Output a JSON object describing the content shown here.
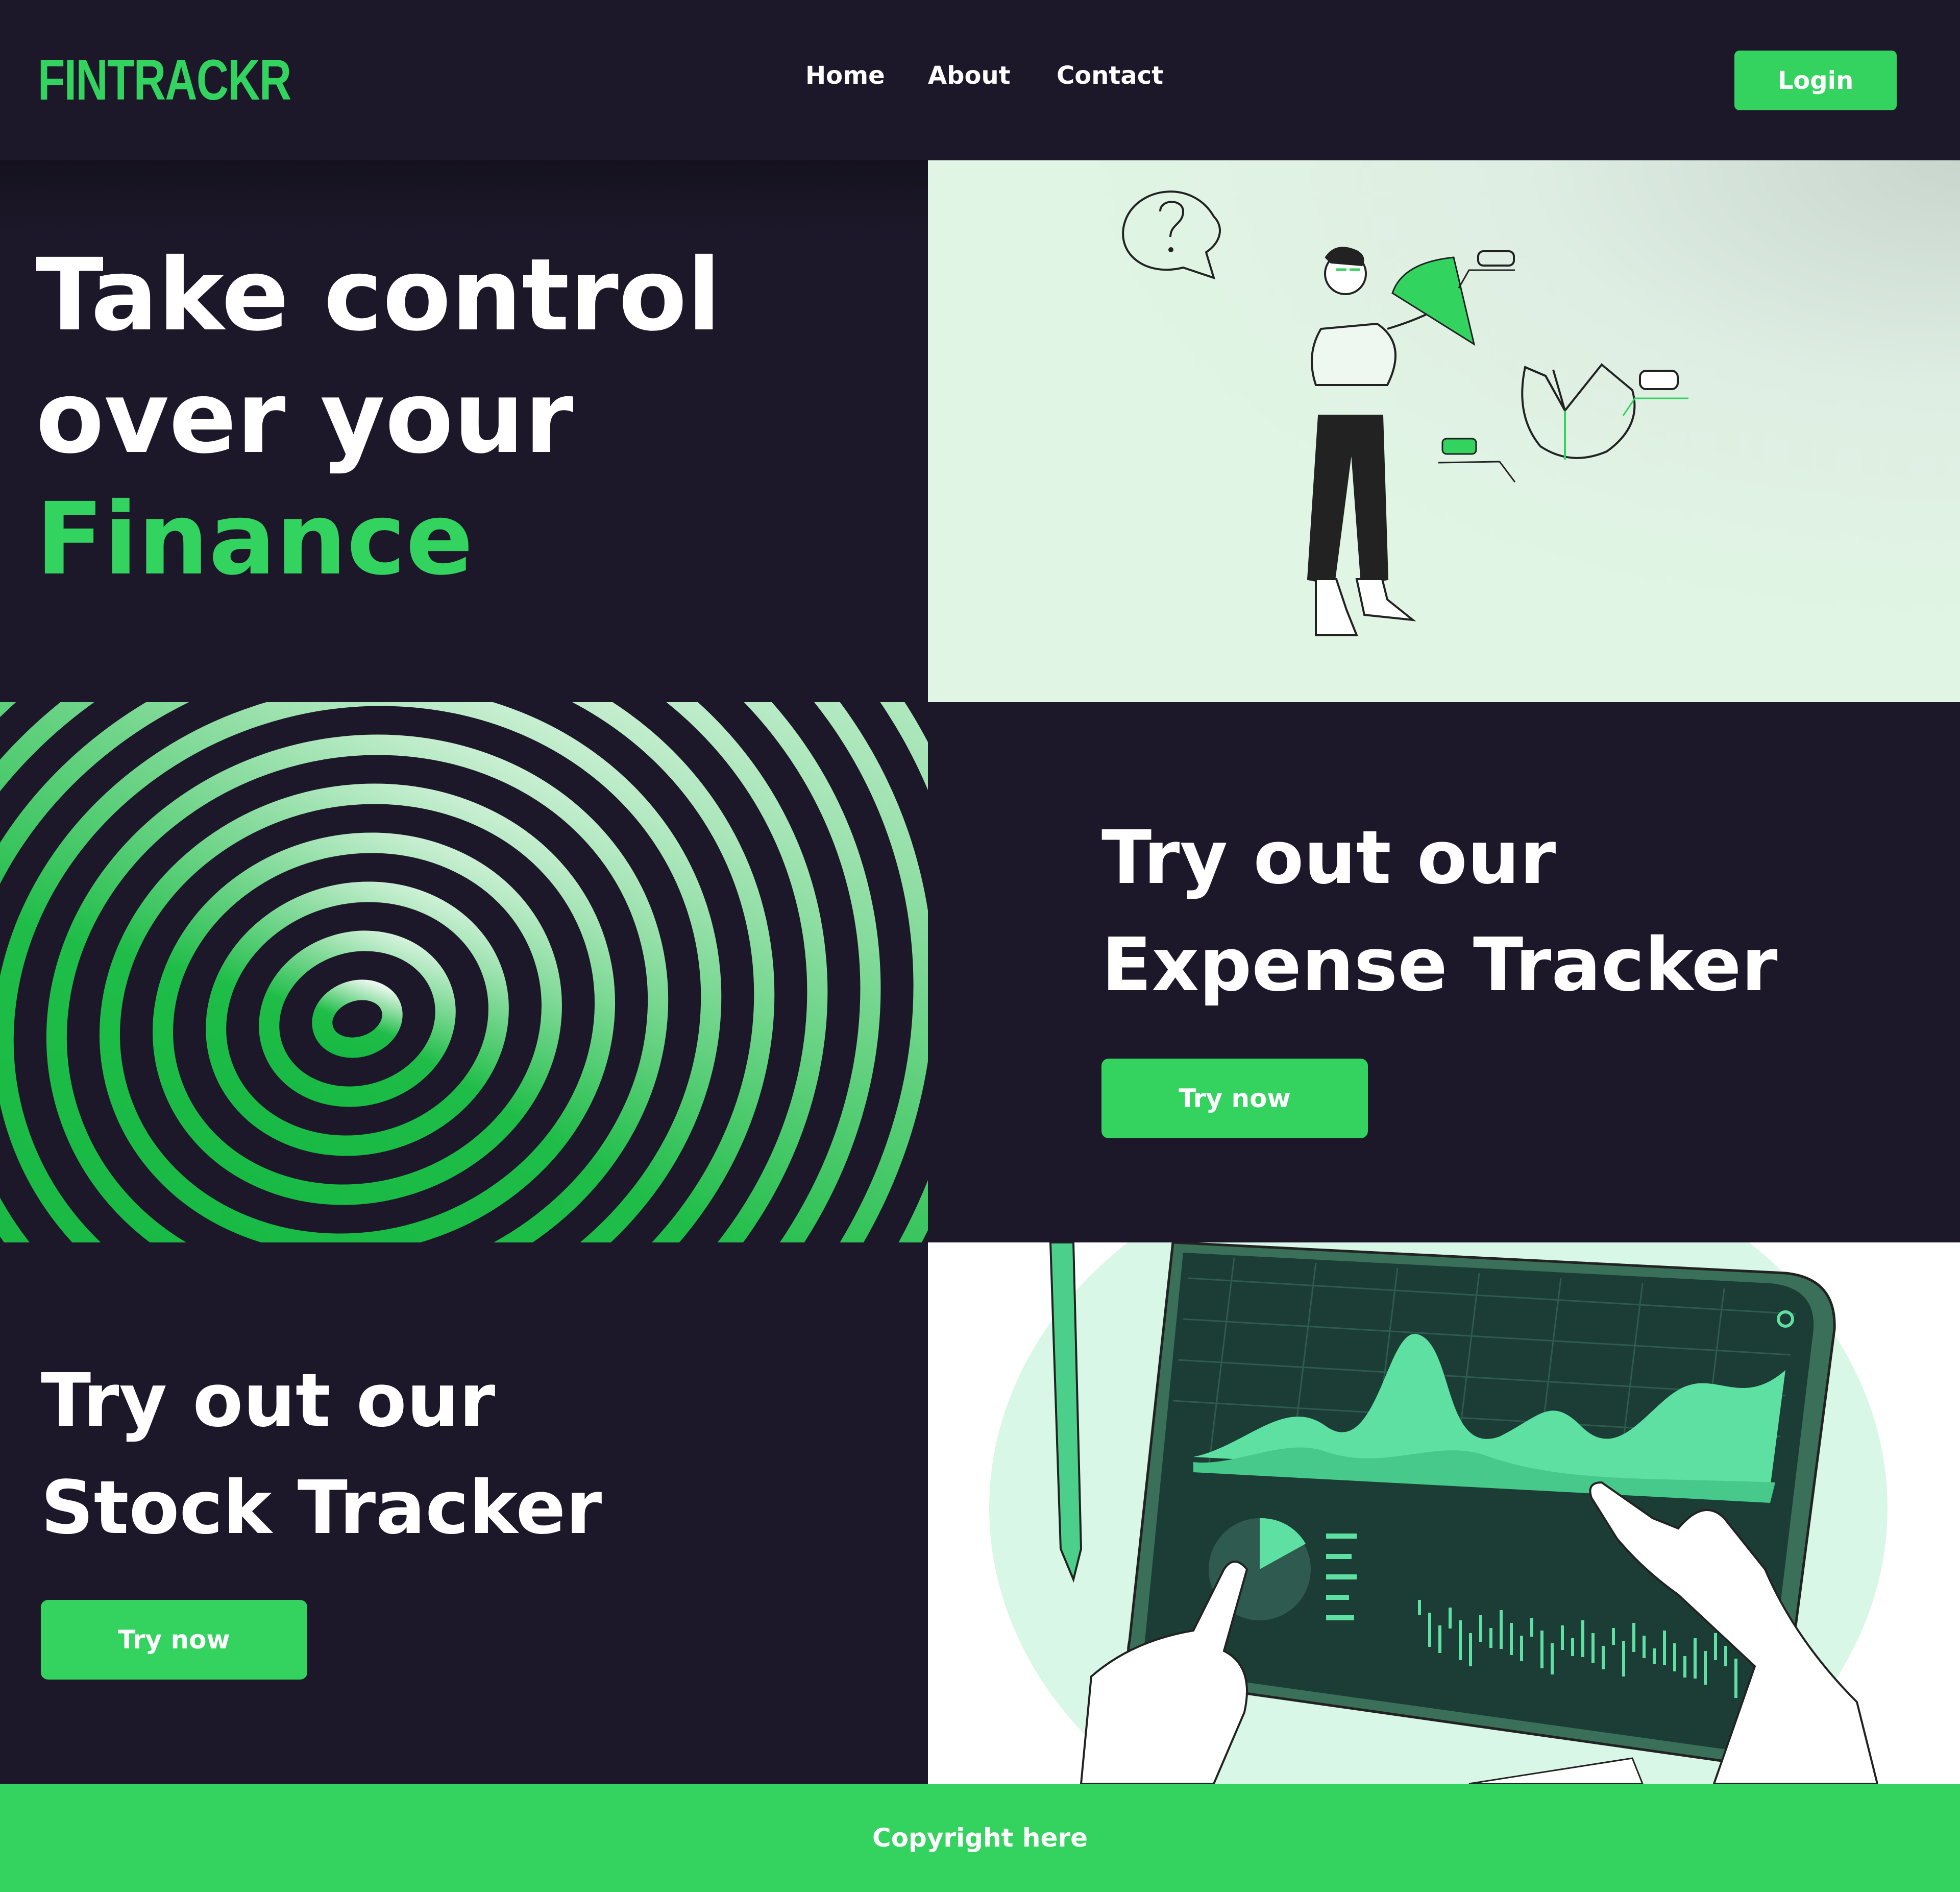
{
  "brand": {
    "logo": "FINTRACKR",
    "accent": "#33d35f",
    "background": "#1c1829"
  },
  "nav": {
    "links": [
      "Home",
      "About",
      "Contact"
    ],
    "login_label": "Login"
  },
  "hero": {
    "line1": "Take control",
    "line2": "over your",
    "line3": "Finance"
  },
  "expense": {
    "line1": "Try out our",
    "line2": "Expense Tracker",
    "button_label": "Try now"
  },
  "stock": {
    "line1": "Try out our",
    "line2": "Stock Tracker",
    "button_label": "Try now"
  },
  "footer": {
    "text": "Copyright here"
  },
  "icons": [
    "question-mark-icon",
    "settings-gear-icon"
  ]
}
